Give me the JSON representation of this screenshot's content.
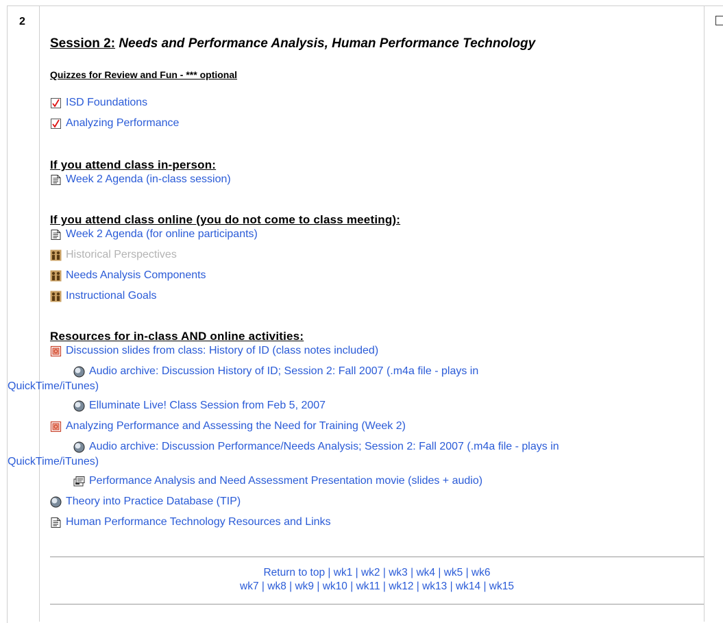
{
  "section_number": "2",
  "title": {
    "prefix": "Session 2:",
    "rest": "Needs and Performance Analysis, Human Performance Technology"
  },
  "quizzes": {
    "heading": "Quizzes for Review and Fun - *** optional",
    "items": [
      {
        "label": "ISD Foundations",
        "icon": "quiz-icon"
      },
      {
        "label": "Analyzing Performance",
        "icon": "quiz-icon"
      }
    ]
  },
  "inperson": {
    "heading": "If you attend class in-person:",
    "items": [
      {
        "label": "Week 2 Agenda (in-class session)",
        "icon": "document-icon"
      }
    ]
  },
  "online": {
    "heading": "If you attend class online (you do not come to class meeting):",
    "items": [
      {
        "label": "Week 2 Agenda (for online participants)",
        "icon": "document-icon",
        "dim": false
      },
      {
        "label": "Historical Perspectives",
        "icon": "forum-icon",
        "dim": true
      },
      {
        "label": "Needs Analysis Components",
        "icon": "forum-icon",
        "dim": false
      },
      {
        "label": "Instructional Goals",
        "icon": "forum-icon",
        "dim": false
      }
    ]
  },
  "resources": {
    "heading": "Resources for in-class AND online activities:",
    "items": [
      {
        "label": "Discussion slides from class: History of ID (class notes included)",
        "icon": "powerpoint-icon"
      },
      {
        "label": "Audio archive: Discussion History of ID; Session 2: Fall 2007 (.m4a file - plays in",
        "label2": "QuickTime/iTunes)",
        "icon": "web-link-icon"
      },
      {
        "label": "Elluminate Live! Class Session from Feb 5, 2007",
        "icon": "web-link-icon"
      },
      {
        "label": "Analyzing Performance and Assessing the Need for Training (Week 2)",
        "icon": "powerpoint-icon"
      },
      {
        "label": "Audio archive: Discussion Performance/Needs Analysis; Session 2: Fall 2007 (.m4a file - plays in",
        "label2": "QuickTime/iTunes)",
        "icon": "web-link-icon"
      },
      {
        "label": "Performance Analysis and Need Assessment Presentation movie (slides + audio)",
        "icon": "movie-icon"
      },
      {
        "label": "Theory into Practice Database (TIP)",
        "icon": "web-link-icon"
      },
      {
        "label": "Human Performance Technology Resources and Links",
        "icon": "document-icon"
      }
    ]
  },
  "nav": {
    "return_to_top": "Return to top",
    "row1": [
      "wk1",
      "wk2",
      "wk3",
      "wk4",
      "wk5",
      "wk6"
    ],
    "row2": [
      "wk7",
      "wk8",
      "wk9",
      "wk10",
      "wk11",
      "wk12",
      "wk13",
      "wk14",
      "wk15"
    ],
    "separator": "|"
  },
  "colors": {
    "link": "#2a5bd7",
    "dim_link": "#b3b3b3",
    "border": "#cfcfcf"
  }
}
